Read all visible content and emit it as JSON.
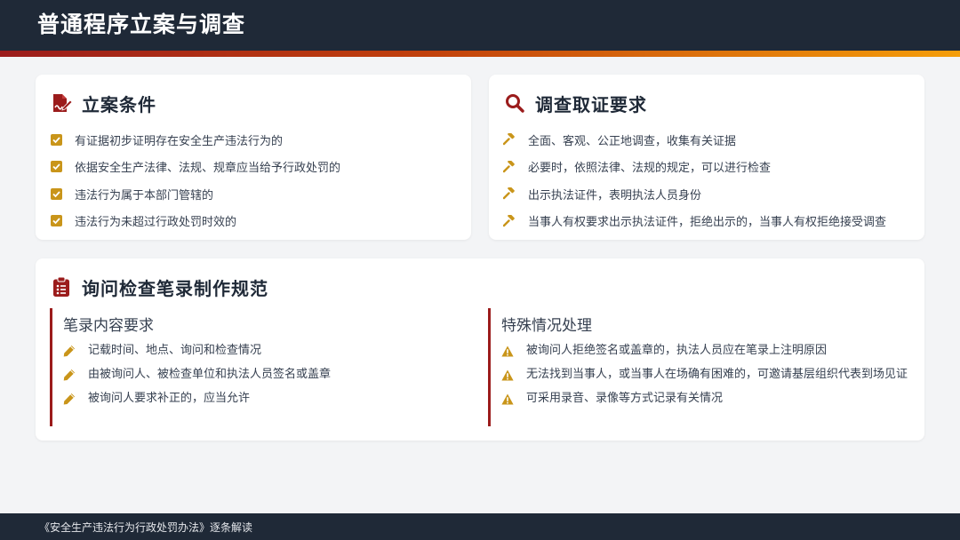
{
  "header": {
    "title": "普通程序立案与调查"
  },
  "colors": {
    "accent_red": "#9b1c1c",
    "accent_gold": "#c9951a",
    "dark": "#1f2937"
  },
  "filing": {
    "icon": "file-signature-icon",
    "title": "立案条件",
    "items": [
      {
        "icon": "check-square-icon",
        "text": "有证据初步证明存在安全生产违法行为的"
      },
      {
        "icon": "check-square-icon",
        "text": "依据安全生产法律、法规、规章应当给予行政处罚的"
      },
      {
        "icon": "check-square-icon",
        "text": "违法行为属于本部门管辖的"
      },
      {
        "icon": "check-square-icon",
        "text": "违法行为未超过行政处罚时效的"
      }
    ]
  },
  "investigation": {
    "icon": "search-icon",
    "title": "调查取证要求",
    "items": [
      {
        "icon": "gavel-icon",
        "text": "全面、客观、公正地调查，收集有关证据"
      },
      {
        "icon": "gavel-icon",
        "text": "必要时，依照法律、法规的规定，可以进行检查"
      },
      {
        "icon": "gavel-icon",
        "text": "出示执法证件，表明执法人员身份"
      },
      {
        "icon": "gavel-icon",
        "text": "当事人有权要求出示执法证件，拒绝出示的，当事人有权拒绝接受调查"
      }
    ]
  },
  "records": {
    "icon": "clipboard-list-icon",
    "title": "询问检查笔录制作规范",
    "content_req": {
      "title": "笔录内容要求",
      "items": [
        {
          "icon": "pencil-icon",
          "text": "记载时间、地点、询问和检查情况"
        },
        {
          "icon": "pencil-icon",
          "text": "由被询问人、被检查单位和执法人员签名或盖章"
        },
        {
          "icon": "pencil-icon",
          "text": "被询问人要求补正的，应当允许"
        }
      ]
    },
    "special": {
      "title": "特殊情况处理",
      "items": [
        {
          "icon": "warning-icon",
          "text": "被询问人拒绝签名或盖章的，执法人员应在笔录上注明原因"
        },
        {
          "icon": "warning-icon",
          "text": "无法找到当事人，或当事人在场确有困难的，可邀请基层组织代表到场见证"
        },
        {
          "icon": "warning-icon",
          "text": "可采用录音、录像等方式记录有关情况"
        }
      ]
    }
  },
  "footer": {
    "text": "《安全生产违法行为行政处罚办法》逐条解读"
  }
}
